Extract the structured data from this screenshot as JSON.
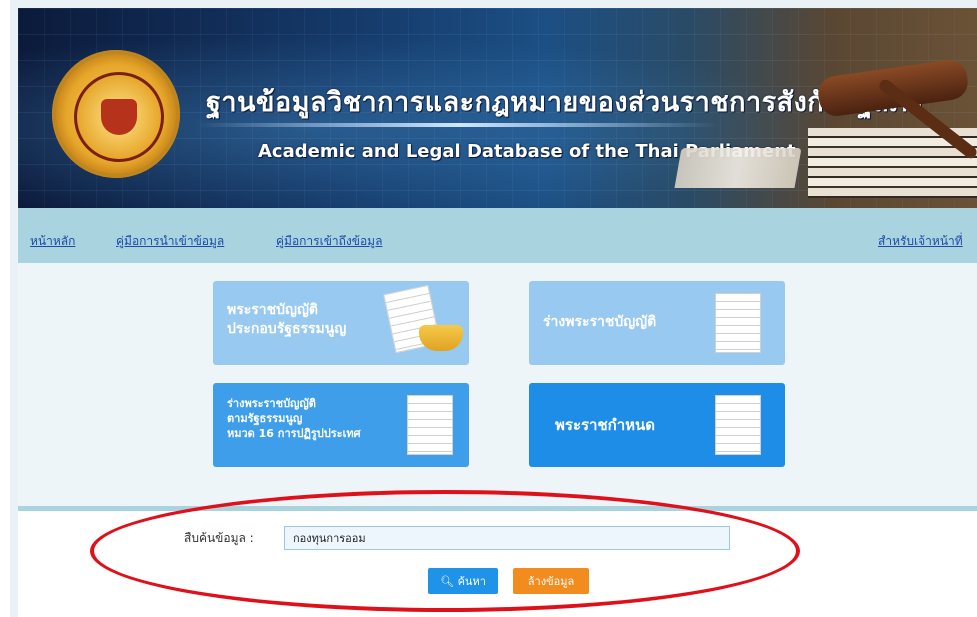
{
  "header": {
    "title_th": "ฐานข้อมูลวิชาการและกฎหมายของส่วนราชการสังกัดรัฐสภา",
    "title_en": "Academic and Legal Database of the Thai Parliament"
  },
  "nav": {
    "items": [
      {
        "label": "หน้าหลัก"
      },
      {
        "label": "คู่มือการนำเข้าข้อมูล"
      },
      {
        "label": "คู่มือการเข้าถึงข้อมูล"
      }
    ],
    "staff_label": "สำหรับเจ้าหน้าที่"
  },
  "tiles": [
    {
      "line1": "พระราชบัญญัติ",
      "line2": "ประกอบรัฐธรรมนูญ"
    },
    {
      "line1": "ร่างพระราชบัญญัติ"
    },
    {
      "line1": "ร่างพระราชบัญญัติ",
      "line2": "ตามรัฐธรรมนูญ",
      "line3": "หมวด 16 การปฏิรูปประเทศ"
    },
    {
      "line1": "พระราชกำหนด"
    }
  ],
  "search": {
    "label": "สืบค้นข้อมูล :",
    "value": "กองทุนการออม",
    "search_button": "ค้นหา",
    "clear_button": "ล้างข้อมูล"
  },
  "colors": {
    "nav_bg": "#a9d3df",
    "tile_light": "#97c9f1",
    "tile_dark": "#1d8de8",
    "search_button": "#1f93e8",
    "clear_button": "#f28c1e",
    "highlight": "#e0101a"
  }
}
